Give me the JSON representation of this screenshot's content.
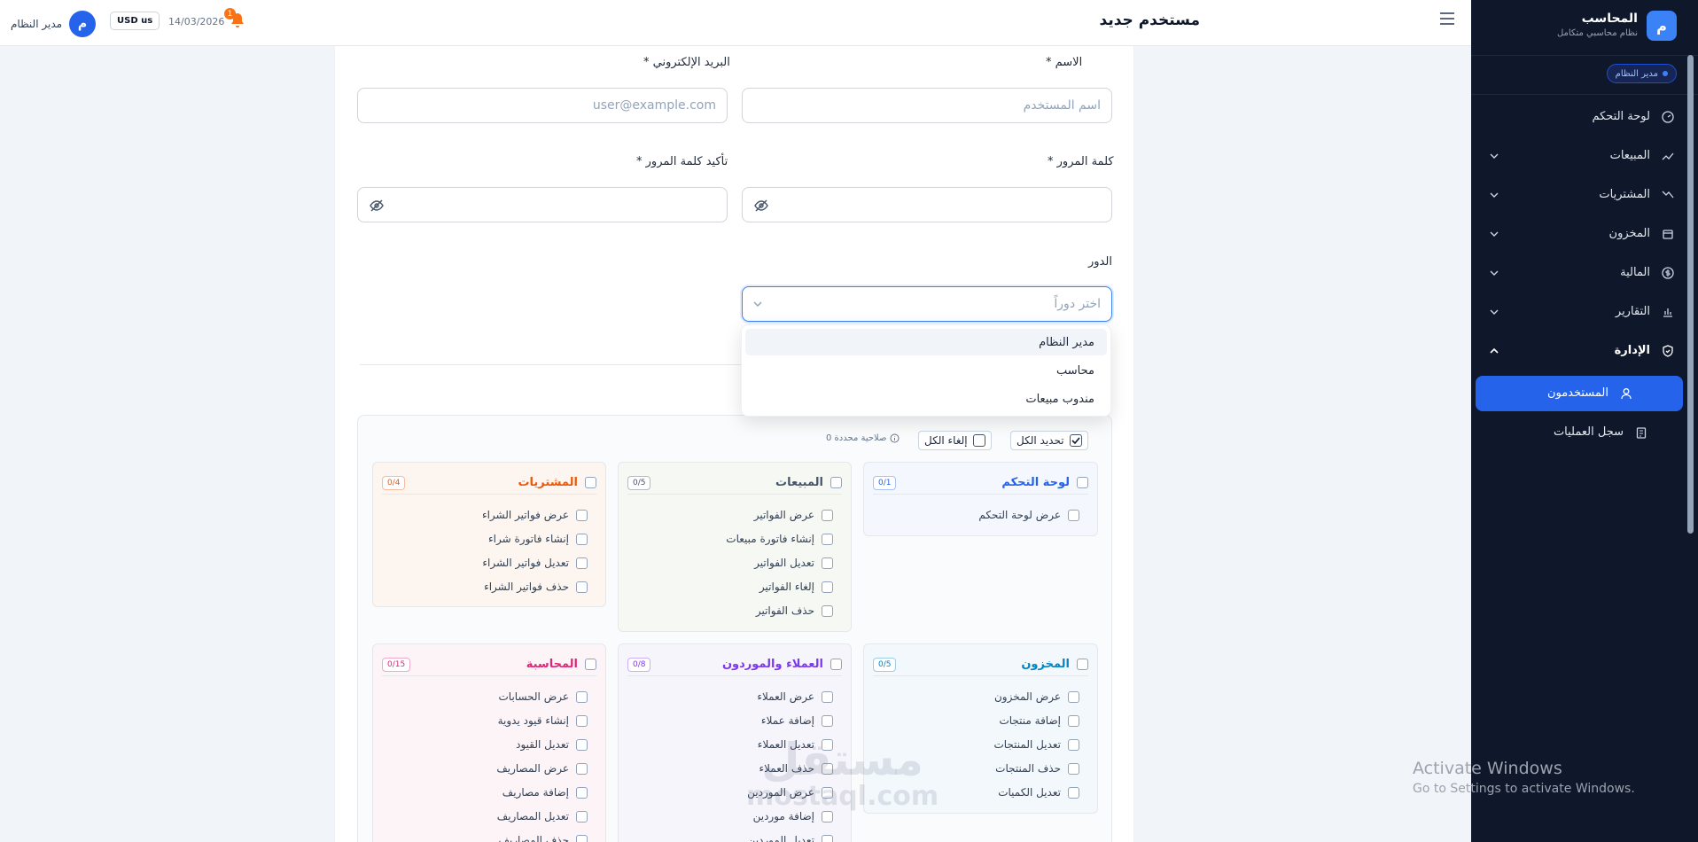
{
  "topbar": {
    "page_title": "مستخدم جديد",
    "user_name": "مدير النظام",
    "avatar_letter": "م",
    "currency": "USD us",
    "date": "14/03/2026",
    "notif_count": "1"
  },
  "form": {
    "name_label": "الاسم *",
    "name_placeholder": "اسم المستخدم",
    "email_label": "البريد الإلكتروني *",
    "email_placeholder": "user@example.com",
    "password_label": "كلمة المرور *",
    "confirm_label": "تأكيد كلمة المرور *",
    "role_label": "الدور",
    "role_placeholder": "اختر دوراً",
    "role_options": [
      "مدير النظام",
      "محاسب",
      "مندوب مبيعات"
    ]
  },
  "permissions": {
    "select_all": "تحديد الكل",
    "deselect_all": "إلغاء الكل",
    "selected_count": "0 صلاحية محددة",
    "groups": [
      {
        "title": "لوحة التحكم",
        "count": "0/1",
        "color": "#2563eb",
        "items": [
          "عرض لوحة التحكم"
        ]
      },
      {
        "title": "المبيعات",
        "count": "0/5",
        "color": "#475569",
        "items": [
          "عرض الفواتير",
          "إنشاء فاتورة مبيعات",
          "تعديل الفواتير",
          "إلغاء الفواتير",
          "حذف الفواتير"
        ]
      },
      {
        "title": "المشتريات",
        "count": "0/4",
        "color": "#ea580c",
        "items": [
          "عرض فواتير الشراء",
          "إنشاء فاتورة شراء",
          "تعديل فواتير الشراء",
          "حذف فواتير الشراء"
        ]
      },
      {
        "title": "المخزون",
        "count": "0/5",
        "color": "#0284c7",
        "items": [
          "عرض المخزون",
          "إضافة منتجات",
          "تعديل المنتجات",
          "حذف المنتجات",
          "تعديل الكميات"
        ]
      },
      {
        "title": "العملاء والموردون",
        "count": "0/8",
        "color": "#7c3aed",
        "items": [
          "عرض العملاء",
          "إضافة عملاء",
          "تعديل العملاء",
          "حذف العملاء",
          "عرض الموردين",
          "إضافة موردين",
          "تعديل الموردين"
        ]
      },
      {
        "title": "المحاسبة",
        "count": "0/15",
        "color": "#db2777",
        "items": [
          "عرض الحسابات",
          "إنشاء قيود يدوية",
          "تعديل القيود",
          "عرض المصاريف",
          "إضافة مصاريف",
          "تعديل المصاريف",
          "حذف المصاريف"
        ]
      }
    ]
  },
  "sidebar": {
    "brand_name": "المحاسب",
    "brand_sub": "نظام محاسبي متكامل",
    "brand_letter": "م",
    "role_badge": "مدير النظام",
    "items": [
      {
        "label": "لوحة التحكم"
      },
      {
        "label": "المبيعات"
      },
      {
        "label": "المشتريات"
      },
      {
        "label": "المخزون"
      },
      {
        "label": "المالية"
      },
      {
        "label": "التقارير"
      },
      {
        "label": "الإدارة"
      },
      {
        "label": "المستخدمون"
      },
      {
        "label": "سجل العمليات"
      }
    ]
  },
  "overlay": {
    "windows_line1": "Activate Windows",
    "windows_line2": "Go to Settings to activate Windows.",
    "watermark_ar": "مستقل",
    "watermark_en": "mostaql.com"
  }
}
